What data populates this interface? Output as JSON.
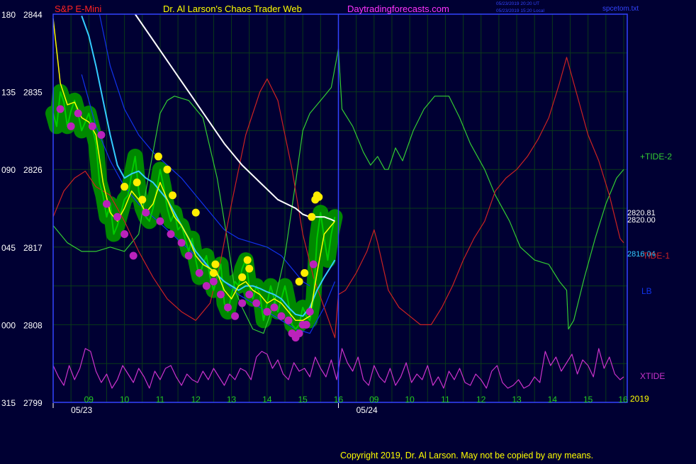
{
  "header": {
    "symbol": "S&P E-Mini",
    "title": "Dr. Al Larson's Chaos Trader Web",
    "site": "Daytradingforecasts.com",
    "stamp_ut": "05/23/2019 20:20 UT",
    "stamp_local": "05/23/2019 15:20 Local",
    "file": "spcetom.txt"
  },
  "footer": {
    "copyright": "Copyright 2019, Dr. Al Larson. May not be copied by any means."
  },
  "colors": {
    "background": "#000033",
    "axis": "#3344ff",
    "grid": "#0a3a1a",
    "price": "#00cc00",
    "price_bands": "#008800",
    "ema_fast": "#ffff00",
    "ema_mid": "#33ccff",
    "ema_slow": "#ffffff",
    "channel": "#1133ee",
    "tide_plus2": "#33cc33",
    "tide_minus1": "#cc2222",
    "xtide": "#cc33cc",
    "pivot_high": "#ffee00",
    "pivot_low": "#bb22bb",
    "left_labels": "#ffffff",
    "time_labels": "#22cc22",
    "red_label": "#ff2222",
    "yellow_text": "#ffff00",
    "magenta_text": "#ff33ff"
  },
  "chart_data": {
    "type": "line",
    "y_left_index": [
      "180",
      "135",
      "090",
      "045",
      "000",
      "315"
    ],
    "y_right_price": [
      "2844",
      "2835",
      "2826",
      "2817",
      "2808",
      "2799"
    ],
    "ylim_price": [
      2799,
      2844
    ],
    "x_ticks": [
      "09",
      "10",
      "11",
      "12",
      "13",
      "14",
      "15",
      "16",
      "09",
      "10",
      "11",
      "12",
      "13",
      "14",
      "15",
      "16"
    ],
    "x_range_hours": [
      8.0,
      24.1
    ],
    "date_labels": [
      {
        "text": "05/23",
        "x": 8.5
      },
      {
        "text": "05/24",
        "x": 16.5
      }
    ],
    "year_label": "2019",
    "divider_x": 16.0,
    "right_values": {
      "close": "2820.81",
      "ema_close": "2820.00",
      "ema_mid": "2816.04"
    },
    "legend": [
      "+TIDE-2",
      "-TIDE-1",
      "LB",
      "XTIDE"
    ],
    "series": {
      "price": {
        "x": [
          8.0,
          8.1,
          8.2,
          8.3,
          8.4,
          8.5,
          8.6,
          8.7,
          8.8,
          8.9,
          9.0,
          9.1,
          9.2,
          9.3,
          9.4,
          9.5,
          9.6,
          9.7,
          9.8,
          9.9,
          10.0,
          10.1,
          10.2,
          10.3,
          10.4,
          10.5,
          10.6,
          10.7,
          10.8,
          10.9,
          11.0,
          11.1,
          11.2,
          11.3,
          11.4,
          11.5,
          11.6,
          11.7,
          11.8,
          11.9,
          12.0,
          12.1,
          12.2,
          12.3,
          12.4,
          12.5,
          12.6,
          12.7,
          12.8,
          12.9,
          13.0,
          13.1,
          13.2,
          13.3,
          13.4,
          13.5,
          13.6,
          13.7,
          13.8,
          13.9,
          14.0,
          14.1,
          14.2,
          14.3,
          14.4,
          14.5,
          14.6,
          14.7,
          14.8,
          14.9,
          15.0,
          15.1,
          15.2,
          15.3,
          15.4,
          15.5,
          15.6,
          15.7,
          15.8,
          15.9
        ],
        "y": [
          2832.5,
          2831.0,
          2835.0,
          2833.8,
          2831.0,
          2832.8,
          2834.0,
          2832.5,
          2830.5,
          2831.5,
          2832.5,
          2830.8,
          2829.0,
          2824.5,
          2823.0,
          2820.5,
          2822.0,
          2818.5,
          2819.5,
          2821.0,
          2822.5,
          2823.0,
          2825.5,
          2827.5,
          2823.5,
          2821.5,
          2820.5,
          2820.0,
          2821.5,
          2823.5,
          2826.0,
          2824.0,
          2821.5,
          2820.0,
          2821.0,
          2819.0,
          2819.5,
          2818.0,
          2816.5,
          2818.0,
          2815.5,
          2813.5,
          2815.0,
          2816.0,
          2813.5,
          2812.0,
          2813.5,
          2815.0,
          2810.5,
          2809.5,
          2811.5,
          2813.0,
          2812.5,
          2814.5,
          2815.5,
          2812.5,
          2811.0,
          2812.5,
          2811.5,
          2808.5,
          2810.5,
          2812.5,
          2811.0,
          2809.5,
          2811.0,
          2812.5,
          2810.5,
          2808.0,
          2807.5,
          2808.0,
          2810.0,
          2809.0,
          2808.5,
          2811.0,
          2818.0,
          2821.0,
          2818.0,
          2815.5,
          2818.5,
          2820.5
        ]
      },
      "ema_fast": {
        "x": [
          8.0,
          8.2,
          8.4,
          8.6,
          8.8,
          9.0,
          9.2,
          9.4,
          9.6,
          9.8,
          10.0,
          10.2,
          10.4,
          10.6,
          10.8,
          11.0,
          11.2,
          11.4,
          11.6,
          11.8,
          12.0,
          12.2,
          12.4,
          12.6,
          12.8,
          13.0,
          13.2,
          13.4,
          13.6,
          13.8,
          14.0,
          14.2,
          14.4,
          14.6,
          14.8,
          15.0,
          15.2,
          15.4,
          15.6,
          15.8,
          15.9
        ],
        "y": [
          2843.5,
          2836.0,
          2833.5,
          2833.8,
          2832.0,
          2831.5,
          2830.0,
          2824.5,
          2821.0,
          2820.0,
          2821.5,
          2823.5,
          2822.5,
          2821.0,
          2822.0,
          2824.5,
          2822.5,
          2820.5,
          2819.5,
          2818.0,
          2816.0,
          2815.0,
          2814.5,
          2814.0,
          2812.0,
          2811.0,
          2812.5,
          2813.0,
          2812.0,
          2811.5,
          2810.5,
          2811.0,
          2810.5,
          2809.5,
          2808.5,
          2808.5,
          2809.0,
          2814.0,
          2818.5,
          2819.5,
          2820.0
        ]
      },
      "ema_mid": {
        "x": [
          8.8,
          9.0,
          9.2,
          9.4,
          9.6,
          9.8,
          10.0,
          10.2,
          10.4,
          10.6,
          10.8,
          11.0,
          11.2,
          11.4,
          11.6,
          11.8,
          12.0,
          12.2,
          12.4,
          12.6,
          12.8,
          13.0,
          13.2,
          13.4,
          13.6,
          13.8,
          14.0,
          14.2,
          14.4,
          14.6,
          14.8,
          15.0,
          15.2,
          15.4,
          15.6,
          15.8,
          15.9
        ],
        "y": [
          2843.8,
          2841.5,
          2838.0,
          2834.0,
          2830.0,
          2826.5,
          2825.0,
          2825.5,
          2825.8,
          2825.0,
          2824.5,
          2823.5,
          2822.5,
          2821.0,
          2819.5,
          2818.0,
          2816.5,
          2815.5,
          2814.5,
          2813.8,
          2813.0,
          2812.5,
          2812.0,
          2812.5,
          2812.5,
          2812.2,
          2811.8,
          2811.5,
          2811.0,
          2810.0,
          2809.2,
          2809.0,
          2810.0,
          2812.0,
          2813.5,
          2814.8,
          2815.5
        ]
      },
      "ema_slow": {
        "x": [
          10.3,
          10.8,
          11.3,
          11.8,
          12.3,
          12.8,
          13.3,
          13.8,
          14.3,
          14.8,
          15.0,
          15.2,
          15.4,
          15.6,
          15.8,
          15.9
        ],
        "y": [
          2844.0,
          2841.0,
          2838.0,
          2835.0,
          2832.0,
          2829.0,
          2826.5,
          2824.5,
          2822.5,
          2821.5,
          2820.8,
          2820.5,
          2820.5,
          2820.5,
          2820.2,
          2820.0
        ]
      },
      "channel_upper": {
        "x": [
          9.3,
          9.6,
          10.0,
          10.4,
          10.8,
          11.2,
          11.6,
          12.0,
          12.4,
          12.8,
          13.2,
          13.6,
          14.0,
          14.4,
          14.8,
          15.0,
          15.2
        ],
        "y": [
          2844.0,
          2838.0,
          2833.0,
          2830.0,
          2828.0,
          2826.5,
          2825.0,
          2823.0,
          2821.0,
          2819.0,
          2818.0,
          2817.5,
          2817.0,
          2816.0,
          2814.0,
          2813.0,
          2812.5
        ]
      },
      "channel_lower": {
        "x": [
          8.8,
          9.2,
          9.6,
          10.0,
          10.4,
          10.8,
          11.2,
          11.6,
          12.0,
          12.4,
          12.8,
          13.2,
          13.6,
          14.0,
          14.4,
          14.8,
          15.2,
          15.6,
          15.9
        ],
        "y": [
          2837.0,
          2831.0,
          2827.0,
          2824.0,
          2822.0,
          2820.5,
          2819.0,
          2817.5,
          2816.0,
          2814.5,
          2813.0,
          2811.5,
          2810.5,
          2809.5,
          2808.5,
          2807.5,
          2807.0,
          2810.0,
          2813.0
        ]
      },
      "tide_plus2": {
        "x": [
          8.0,
          8.4,
          8.8,
          9.2,
          9.6,
          10.0,
          10.4,
          10.6,
          10.8,
          11.0,
          11.2,
          11.4,
          11.8,
          12.2,
          12.6,
          12.9,
          13.1,
          13.3,
          13.6,
          13.9,
          14.2,
          14.5,
          14.8,
          15.0,
          15.2,
          15.4,
          15.6,
          15.8,
          16.0,
          16.1,
          16.4,
          16.7,
          16.9,
          17.1,
          17.3,
          17.4,
          17.6,
          17.8,
          18.1,
          18.4,
          18.7,
          19.1,
          19.4,
          19.7,
          20.1,
          20.4,
          20.8,
          21.1,
          21.5,
          21.9,
          22.2,
          22.4,
          22.45,
          22.6,
          22.9,
          23.2,
          23.5,
          23.8,
          24.0
        ],
        "y": [
          2819.5,
          2817.5,
          2816.5,
          2816.5,
          2817.0,
          2816.5,
          2818.5,
          2823.5,
          2828.0,
          2832.5,
          2834.0,
          2834.5,
          2834.0,
          2832.0,
          2825.0,
          2817.5,
          2812.0,
          2810.0,
          2807.5,
          2807.0,
          2810.5,
          2816.0,
          2824.5,
          2830.5,
          2832.5,
          2833.5,
          2834.5,
          2835.5,
          2840.0,
          2833.0,
          2831.0,
          2828.0,
          2826.5,
          2827.5,
          2826.0,
          2826.0,
          2828.5,
          2827.0,
          2830.5,
          2833.0,
          2834.5,
          2834.5,
          2832.0,
          2829.0,
          2826.0,
          2823.0,
          2820.0,
          2817.0,
          2815.5,
          2815.0,
          2813.0,
          2812.0,
          2807.5,
          2808.5,
          2813.5,
          2818.0,
          2822.0,
          2825.0,
          2826.0
        ]
      },
      "tide_minus1": {
        "x": [
          8.0,
          8.3,
          8.6,
          8.9,
          9.2,
          9.6,
          10.0,
          10.4,
          10.8,
          11.2,
          11.6,
          12.0,
          12.4,
          12.7,
          13.0,
          13.4,
          13.8,
          14.0,
          14.3,
          14.7,
          15.0,
          15.3,
          15.6,
          15.9,
          16.0,
          16.2,
          16.5,
          16.8,
          17.0,
          17.1,
          17.4,
          17.7,
          18.0,
          18.3,
          18.6,
          18.9,
          19.2,
          19.5,
          19.8,
          20.1,
          20.4,
          20.7,
          21.0,
          21.3,
          21.6,
          21.9,
          22.2,
          22.4,
          22.5,
          22.7,
          23.0,
          23.3,
          23.6,
          23.9,
          24.0
        ],
        "y": [
          2820.5,
          2823.5,
          2825.0,
          2825.8,
          2824.0,
          2823.0,
          2820.0,
          2816.5,
          2813.5,
          2811.0,
          2809.5,
          2808.5,
          2810.5,
          2815.5,
          2822.0,
          2830.0,
          2835.0,
          2836.5,
          2834.0,
          2826.0,
          2818.5,
          2813.5,
          2810.0,
          2806.5,
          2811.5,
          2812.0,
          2814.0,
          2816.5,
          2819.0,
          2817.5,
          2812.0,
          2810.0,
          2809.0,
          2808.0,
          2808.0,
          2810.0,
          2812.5,
          2815.5,
          2818.0,
          2820.0,
          2823.5,
          2825.0,
          2826.0,
          2827.5,
          2829.5,
          2832.0,
          2836.0,
          2839.0,
          2837.5,
          2834.5,
          2830.0,
          2827.0,
          2823.0,
          2818.0,
          2817.5
        ]
      },
      "xtide": {
        "x": [
          8.0,
          8.15,
          8.3,
          8.45,
          8.6,
          8.75,
          8.9,
          9.05,
          9.2,
          9.35,
          9.5,
          9.65,
          9.8,
          9.95,
          10.1,
          10.25,
          10.4,
          10.55,
          10.7,
          10.85,
          11.0,
          11.15,
          11.3,
          11.45,
          11.6,
          11.75,
          11.9,
          12.05,
          12.2,
          12.35,
          12.5,
          12.65,
          12.8,
          12.95,
          13.1,
          13.25,
          13.4,
          13.55,
          13.7,
          13.85,
          14.0,
          14.15,
          14.3,
          14.45,
          14.6,
          14.75,
          14.9,
          15.05,
          15.2,
          15.35,
          15.5,
          15.65,
          15.8,
          15.95,
          16.1,
          16.25,
          16.4,
          16.55,
          16.7,
          16.85,
          17.0,
          17.15,
          17.3,
          17.45,
          17.6,
          17.75,
          17.9,
          18.05,
          18.2,
          18.35,
          18.5,
          18.65,
          18.8,
          18.95,
          19.1,
          19.25,
          19.4,
          19.55,
          19.7,
          19.85,
          20.0,
          20.15,
          20.3,
          20.45,
          20.6,
          20.75,
          20.9,
          21.05,
          21.2,
          21.35,
          21.5,
          21.65,
          21.8,
          21.95,
          22.1,
          22.25,
          22.4,
          22.55,
          22.7,
          22.85,
          23.0,
          23.15,
          23.3,
          23.45,
          23.6,
          23.75,
          23.9,
          24.0
        ],
        "y": [
          0.55,
          0.35,
          0.2,
          0.55,
          0.3,
          0.5,
          0.85,
          0.8,
          0.45,
          0.25,
          0.4,
          0.15,
          0.3,
          0.55,
          0.4,
          0.25,
          0.5,
          0.35,
          0.15,
          0.45,
          0.3,
          0.5,
          0.55,
          0.35,
          0.2,
          0.4,
          0.3,
          0.25,
          0.45,
          0.3,
          0.5,
          0.35,
          0.2,
          0.4,
          0.3,
          0.5,
          0.45,
          0.3,
          0.7,
          0.8,
          0.75,
          0.5,
          0.65,
          0.4,
          0.3,
          0.6,
          0.45,
          0.5,
          0.35,
          0.7,
          0.5,
          0.35,
          0.65,
          0.3,
          0.85,
          0.6,
          0.45,
          0.7,
          0.3,
          0.2,
          0.55,
          0.35,
          0.25,
          0.5,
          0.2,
          0.35,
          0.6,
          0.25,
          0.4,
          0.3,
          0.55,
          0.2,
          0.35,
          0.15,
          0.45,
          0.3,
          0.5,
          0.25,
          0.2,
          0.4,
          0.3,
          0.15,
          0.45,
          0.55,
          0.25,
          0.15,
          0.2,
          0.3,
          0.15,
          0.2,
          0.35,
          0.25,
          0.8,
          0.55,
          0.7,
          0.45,
          0.6,
          0.75,
          0.4,
          0.65,
          0.55,
          0.35,
          0.85,
          0.5,
          0.7,
          0.4,
          0.3,
          0.35
        ]
      }
    },
    "pivot_highs": {
      "x": [
        10.0,
        10.35,
        10.5,
        10.95,
        11.2,
        11.35,
        12.0,
        12.5,
        12.55,
        13.3,
        13.45,
        13.5,
        14.9,
        15.05,
        15.25,
        15.35,
        15.4,
        15.45
      ],
      "y": [
        2824.0,
        2824.5,
        2822.5,
        2827.5,
        2826.0,
        2823.0,
        2821.0,
        2814.0,
        2815.0,
        2813.5,
        2815.5,
        2814.5,
        2813.0,
        2814.0,
        2820.5,
        2822.5,
        2823.0,
        2822.8
      ]
    },
    "pivot_lows": {
      "x": [
        8.2,
        8.5,
        8.7,
        9.1,
        9.35,
        9.5,
        9.8,
        10.0,
        10.25,
        10.6,
        11.0,
        11.3,
        11.6,
        11.8,
        12.1,
        12.3,
        12.5,
        12.7,
        12.9,
        13.1,
        13.3,
        13.5,
        13.7,
        14.0,
        14.2,
        14.4,
        14.6,
        14.7,
        14.8,
        14.9,
        15.0,
        15.1,
        15.2,
        15.3
      ],
      "y": [
        2833.0,
        2831.0,
        2832.5,
        2831.0,
        2830.0,
        2822.0,
        2820.5,
        2818.5,
        2816.0,
        2821.0,
        2820.0,
        2818.5,
        2817.5,
        2816.0,
        2814.0,
        2812.5,
        2813.0,
        2811.5,
        2810.0,
        2809.0,
        2810.5,
        2811.5,
        2810.5,
        2809.5,
        2810.0,
        2809.0,
        2808.5,
        2807.0,
        2806.5,
        2807.0,
        2808.0,
        2808.0,
        2809.5,
        2815.0
      ]
    }
  }
}
